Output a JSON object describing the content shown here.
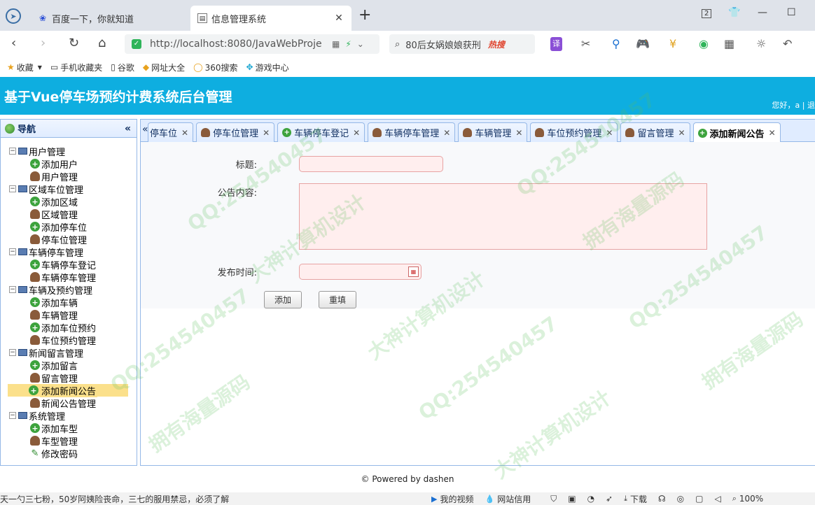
{
  "browser": {
    "tabs": [
      {
        "title": "百度一下，你就知道",
        "favicon": "baidu-paw-icon"
      },
      {
        "title": "信息管理系统",
        "favicon": "page-icon"
      }
    ],
    "tab_counter": "2",
    "url": "http://localhost:8080/JavaWebProje",
    "search_text": "80后女娲娘娘获刑",
    "search_hot": "热搜",
    "bookmarks": [
      "收藏",
      "手机收藏夹",
      "谷歌",
      "网址大全",
      "360搜索",
      "游戏中心"
    ]
  },
  "app": {
    "title": "基于Vue停车场预约计费系统后台管理",
    "user_text": "您好，a | 退"
  },
  "sidebar": {
    "header": "导航",
    "groups": [
      {
        "label": "用户管理",
        "items": [
          "添加用户",
          "用户管理"
        ]
      },
      {
        "label": "区域车位管理",
        "items": [
          "添加区域",
          "区域管理",
          "添加停车位",
          "停车位管理"
        ]
      },
      {
        "label": "车辆停车管理",
        "items": [
          "车辆停车登记",
          "车辆停车管理"
        ]
      },
      {
        "label": "车辆及预约管理",
        "items": [
          "添加车辆",
          "车辆管理",
          "添加车位预约",
          "车位预约管理"
        ]
      },
      {
        "label": "新闻留言管理",
        "items": [
          "添加留言",
          "留言管理",
          "添加新闻公告",
          "新闻公告管理"
        ]
      },
      {
        "label": "系统管理",
        "items": [
          "添加车型",
          "车型管理",
          "修改密码"
        ]
      }
    ],
    "selected": "添加新闻公告"
  },
  "tabs": [
    "停车位",
    "停车位管理",
    "车辆停车登记",
    "车辆停车管理",
    "车辆管理",
    "车位预约管理",
    "留言管理",
    "添加新闻公告"
  ],
  "form": {
    "title_label": "标题:",
    "title_value": "",
    "content_label": "公告内容:",
    "content_value": "",
    "time_label": "发布时间:",
    "time_value": "",
    "add_button": "添加",
    "reset_button": "重填"
  },
  "footer": "© Powered by dashen",
  "statusbar": {
    "news": "天一勺三七粉，50岁阿姨险丧命，三七的服用禁忌，必须了解",
    "items": [
      "我的视频",
      "网站信用",
      "下载",
      "100%"
    ]
  },
  "watermarks": [
    "QQ:254540457",
    "大神计算机设计",
    "拥有海量源码"
  ],
  "colors": {
    "header": "#0eaee0",
    "tab_border": "#95b8e7",
    "selected_bg": "#fbe08b",
    "input_bg": "#ffeeee"
  }
}
